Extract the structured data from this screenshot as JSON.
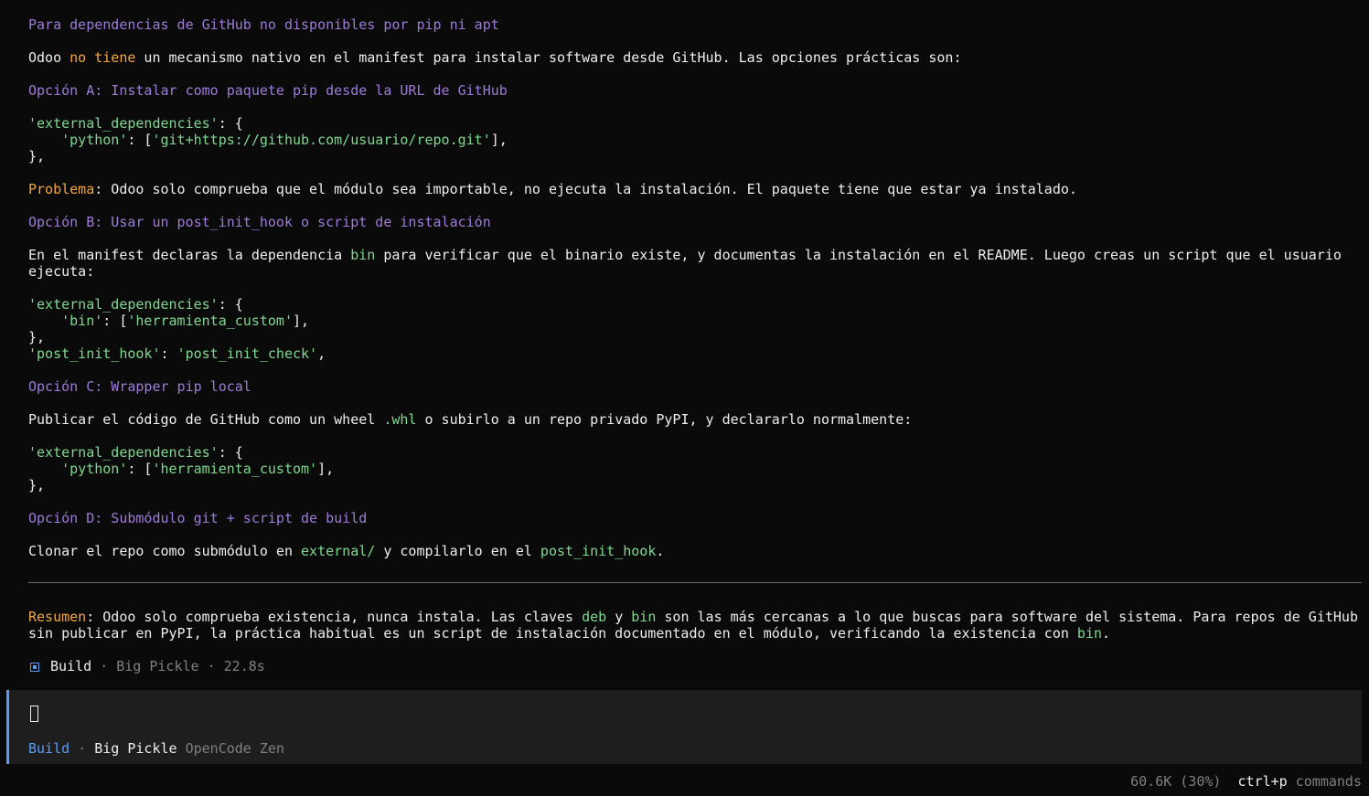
{
  "transcript": {
    "heading_github": "Para dependencias de GitHub no disponibles por pip ni apt",
    "intro": {
      "pre": "Odoo ",
      "highlight": "no tiene",
      "post": " un mecanismo nativo en el manifest para instalar software desde GitHub. Las opciones prácticas son:"
    },
    "option_a": {
      "heading": "Opción A: Instalar como paquete pip desde la URL de GitHub",
      "code": {
        "l1_key": "'external_dependencies'",
        "l1_rest": ": {",
        "l2_indent": "    ",
        "l2_key": "'python'",
        "l2_mid": ": [",
        "l2_val": "'git+https://github.com/usuario/repo.git'",
        "l2_end": "],",
        "l3": "},"
      },
      "problem_label": "Problema",
      "problem_text": ": Odoo solo comprueba que el módulo sea importable, no ejecuta la instalación. El paquete tiene que estar ya instalado."
    },
    "option_b": {
      "heading": "Opción B: Usar un post_init_hook o script de instalación",
      "desc_pre": "En el manifest declaras la dependencia ",
      "desc_code": "bin",
      "desc_post": " para verificar que el binario existe, y documentas la instalación en el README. Luego creas un script que el usuario",
      "desc_line2": "ejecuta:",
      "code": {
        "l1_key": "'external_dependencies'",
        "l1_rest": ": {",
        "l2_indent": "    ",
        "l2_key": "'bin'",
        "l2_mid": ": [",
        "l2_val": "'herramienta_custom'",
        "l2_end": "],",
        "l3": "},",
        "l4_key": "'post_init_hook'",
        "l4_mid": ": ",
        "l4_val": "'post_init_check'",
        "l4_end": ","
      }
    },
    "option_c": {
      "heading": "Opción C: Wrapper pip local",
      "desc_pre": "Publicar el código de GitHub como un wheel ",
      "desc_code": ".whl",
      "desc_post": " o subirlo a un repo privado PyPI, y declararlo normalmente:",
      "code": {
        "l1_key": "'external_dependencies'",
        "l1_rest": ": {",
        "l2_indent": "    ",
        "l2_key": "'python'",
        "l2_mid": ": [",
        "l2_val": "'herramienta_custom'",
        "l2_end": "],",
        "l3": "},"
      }
    },
    "option_d": {
      "heading": "Opción D: Submódulo git + script de build",
      "desc_pre": "Clonar el repo como submódulo en ",
      "desc_code1": "external/",
      "desc_mid": " y compilarlo en el ",
      "desc_code2": "post_init_hook",
      "desc_end": "."
    },
    "summary": {
      "label": "Resumen",
      "text1": ": Odoo solo comprueba existencia, nunca instala. Las claves ",
      "code1": "deb",
      "text2": " y ",
      "code2": "bin",
      "text3": " son las más cercanas a lo que buscas para software del sistema. Para repos de GitHub",
      "line2_pre": "sin publicar en PyPI, la práctica habitual es un script de instalación documentado en el módulo, verificando la existencia con ",
      "line2_code": "bin",
      "line2_end": "."
    },
    "run_info": {
      "mode": "Build",
      "sep1": " · ",
      "model": "Big Pickle",
      "sep2": " · ",
      "duration": "22.8s"
    }
  },
  "input_panel": {
    "mode": "Build",
    "sep": " · ",
    "model": "Big Pickle",
    "provider": "OpenCode Zen"
  },
  "status_bar": {
    "context_usage": "60.6K (30%)",
    "shortcut_key": "ctrl+p",
    "shortcut_label": "commands"
  },
  "colors": {
    "background": "#0a0a0a",
    "heading": "#9d7cd8",
    "highlight": "#f5a742",
    "code": "#7fd88f",
    "accent": "#5c9cf5",
    "muted": "#808080",
    "panel": "#1e1e1e"
  }
}
